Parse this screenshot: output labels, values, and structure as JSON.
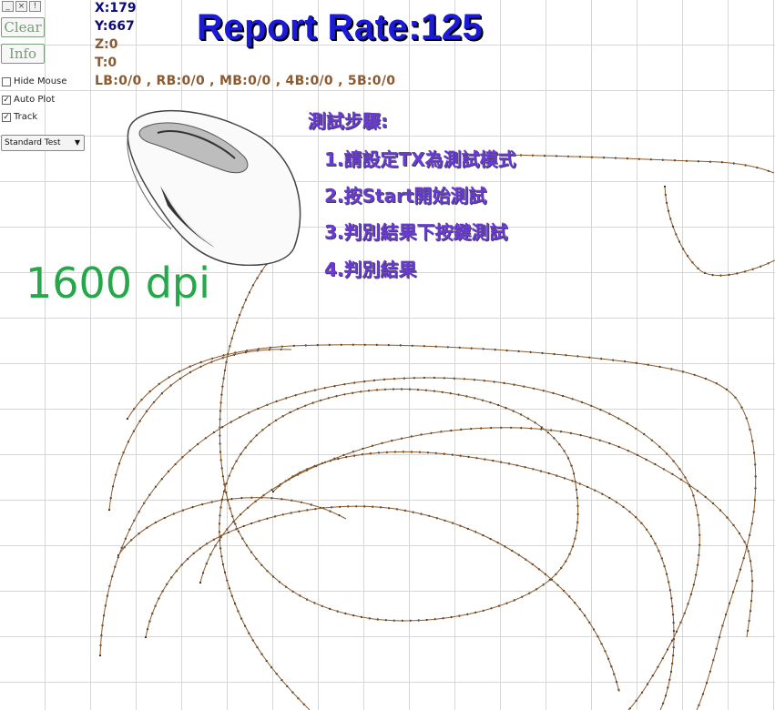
{
  "window_controls": [
    "_",
    "×",
    "!"
  ],
  "buttons": {
    "clear": "Clear",
    "info": "Info"
  },
  "options": {
    "hide_mouse": {
      "label": "Hide Mouse",
      "checked": false
    },
    "auto_plot": {
      "label": "Auto Plot",
      "checked": true
    },
    "track": {
      "label": "Track",
      "checked": true
    }
  },
  "mode_select": {
    "value": "Standard Test"
  },
  "readouts": {
    "x": "X:179",
    "y": "Y:667",
    "z": "Z:0",
    "t": "T:0",
    "buttons": "LB:0/0 , RB:0/0 , MB:0/0  , 4B:0/0  , 5B:0/0"
  },
  "report_rate": "Report Rate:125",
  "dpi_label": "1600 dpi",
  "instructions": {
    "heading": "測試步驟:",
    "steps": [
      "1.請設定TX為測試模式",
      "2.按Start開始測試",
      "3.判別結果下按鍵測試",
      "4.判別結果"
    ]
  },
  "colors": {
    "track_line": "#8a5a2a",
    "track_dot": "#111111"
  }
}
